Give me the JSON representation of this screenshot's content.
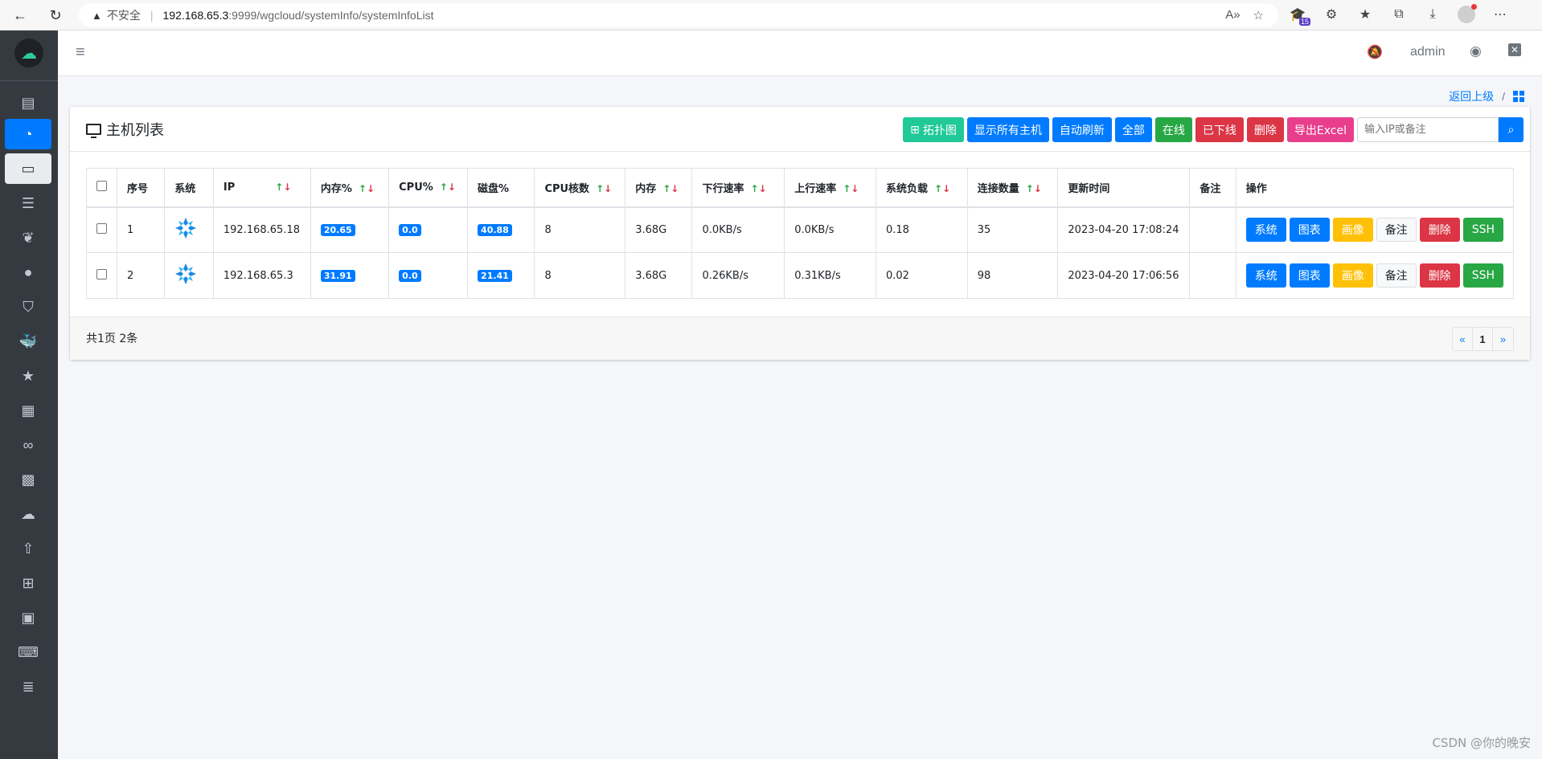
{
  "browser": {
    "insecure": "不安全",
    "url_host": "192.168.65.3",
    "url_path": ":9999/wgcloud/systemInfo/systemInfoList",
    "badge_count": "15"
  },
  "topnav": {
    "username": "admin"
  },
  "breadcrumb": {
    "back": "返回上级",
    "slash": "/"
  },
  "card": {
    "title": "主机列表",
    "buttons": {
      "topology": "拓扑图",
      "show_all": "显示所有主机",
      "auto_refresh": "自动刷新",
      "all": "全部",
      "online": "在线",
      "offline": "已下线",
      "delete": "删除",
      "export": "导出Excel"
    },
    "search_placeholder": "输入IP或备注"
  },
  "table": {
    "headers": [
      "序号",
      "系统",
      "IP",
      "内存%",
      "CPU%",
      "磁盘%",
      "CPU核数",
      "内存",
      "下行速率",
      "上行速率",
      "系统负载",
      "连接数量",
      "更新时间",
      "备注",
      "操作"
    ],
    "sort_up": "↑",
    "sort_down": "↓",
    "rows": [
      {
        "no": "1",
        "ip": "192.168.65.18",
        "mem_pct": "20.65",
        "cpu_pct": "0.0",
        "disk_pct": "40.88",
        "cores": "8",
        "mem": "3.68G",
        "down": "0.0KB/s",
        "up": "0.0KB/s",
        "load": "0.18",
        "conns": "35",
        "updated": "2023-04-20 17:08:24",
        "remark": ""
      },
      {
        "no": "2",
        "ip": "192.168.65.3",
        "mem_pct": "31.91",
        "cpu_pct": "0.0",
        "disk_pct": "21.41",
        "cores": "8",
        "mem": "3.68G",
        "down": "0.26KB/s",
        "up": "0.31KB/s",
        "load": "0.02",
        "conns": "98",
        "updated": "2023-04-20 17:06:56",
        "remark": ""
      }
    ],
    "ops": {
      "system": "系统",
      "chart": "图表",
      "portrait": "画像",
      "note": "备注",
      "delete": "删除",
      "ssh": "SSH"
    }
  },
  "pagination": {
    "info": "共1页 2条",
    "prev": "«",
    "current": "1",
    "next": "»"
  },
  "watermark": "CSDN @你的晚安",
  "colors": {
    "primary": "#007bff",
    "success": "#28a745",
    "danger": "#dc3545",
    "teal": "#20c997",
    "pink": "#e83e8c",
    "warning": "#ffc107",
    "sidebar": "#343a40"
  },
  "icons": {
    "sidebar": [
      "book-icon",
      "dashboard-icon",
      "desktop-icon",
      "list-icon",
      "leaf-icon",
      "comment-icon",
      "shield-icon",
      "docker-icon",
      "star-icon",
      "table-icon",
      "link-icon",
      "th-icon",
      "cloud-icon",
      "cloud-upload-icon",
      "sitemap-icon",
      "calendar-icon",
      "laptop-code-icon",
      "server-icon"
    ]
  }
}
